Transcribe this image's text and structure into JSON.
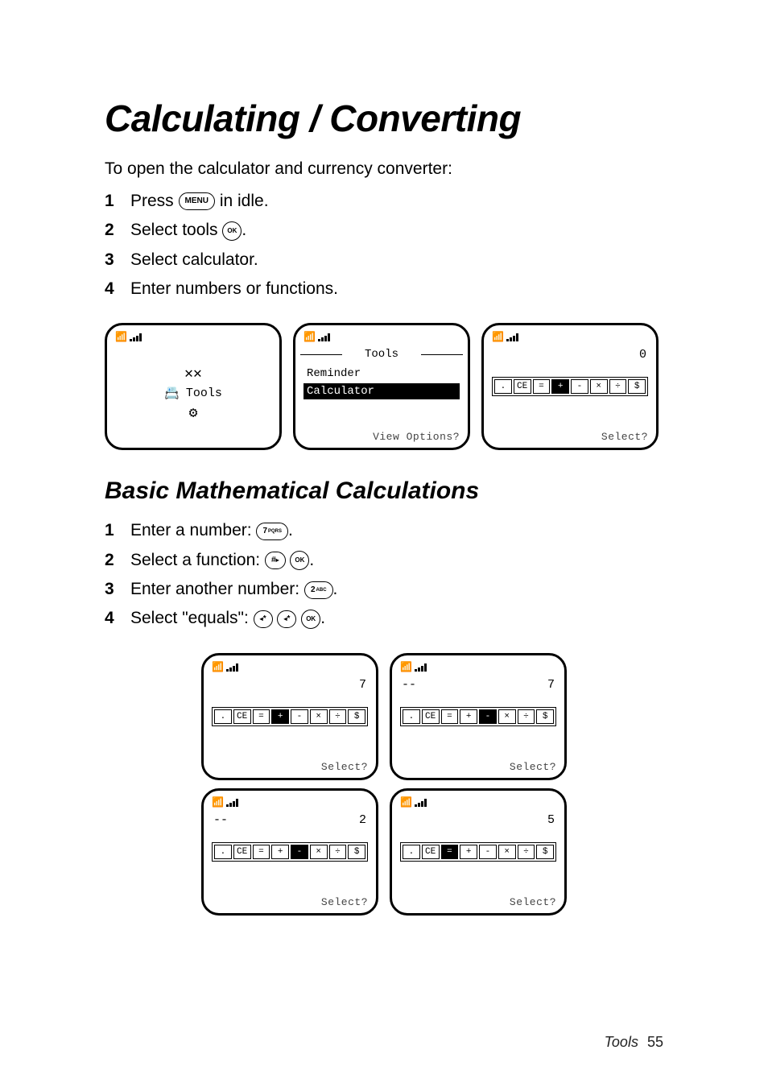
{
  "title": "Calculating / Converting",
  "intro": "To open the calculator and currency converter:",
  "steps_a": {
    "s1_a": "Press",
    "s1_key": "MENU",
    "s1_b": "in idle.",
    "s2_a": "Select tools",
    "s2_key": "OK",
    "s2_b": ".",
    "s3": "Select calculator.",
    "s4": "Enter numbers or functions."
  },
  "screens_top": {
    "carousel_label": "Tools",
    "list_title": "Tools",
    "list_items": [
      "Reminder",
      "Calculator"
    ],
    "list_soft": "View Options?",
    "calc_value": "0",
    "calc_soft": "Select?"
  },
  "subtitle": "Basic Mathematical Calculations",
  "steps_b": {
    "s1_a": "Enter a number:",
    "s1_key": "7",
    "s1_key_sub": "PQRS",
    "s2_a": "Select a function:",
    "s2_key1_main": "#",
    "s2_key1_tri": "▸",
    "s2_key2": "OK",
    "s3_a": "Enter another number:",
    "s3_key": "2",
    "s3_key_sub": "ABC",
    "s4_a": "Select \"equals\":",
    "s4_key_main": "*",
    "s4_key_tri": "◂",
    "s4_key3": "OK"
  },
  "calc_screens": {
    "a": {
      "op": "",
      "val": "7",
      "sel": "+",
      "soft": "Select?"
    },
    "b": {
      "op": "--",
      "val": "7",
      "sel": "-",
      "soft": "Select?"
    },
    "c": {
      "op": "--",
      "val": "2",
      "sel": "-",
      "soft": "Select?"
    },
    "d": {
      "op": "",
      "val": "5",
      "sel": "=",
      "soft": "Select?"
    }
  },
  "func_labels": [
    ".",
    "CE",
    "=",
    "+",
    "-",
    "×",
    "÷",
    "$"
  ],
  "footer_label": "Tools",
  "footer_page": "55"
}
